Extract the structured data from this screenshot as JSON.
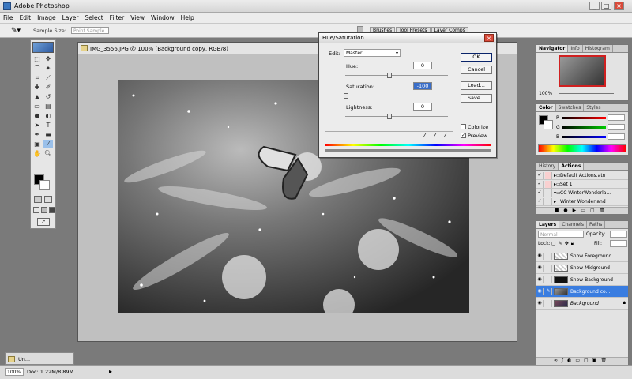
{
  "app": {
    "title": "Adobe Photoshop"
  },
  "menu": [
    "File",
    "Edit",
    "Image",
    "Layer",
    "Select",
    "Filter",
    "View",
    "Window",
    "Help"
  ],
  "options": {
    "sample_label": "Sample Size:",
    "sample_value": "Point Sample",
    "tabs": [
      "Brushes",
      "Tool Presets",
      "Layer Comps"
    ]
  },
  "document": {
    "title": "IMG_3556.JPG @ 100% (Background copy, RGB/8)"
  },
  "minimized": {
    "label": "Un..."
  },
  "dialog": {
    "title": "Hue/Saturation",
    "edit_label": "Edit:",
    "edit_value": "Master",
    "hue_label": "Hue:",
    "hue_value": "0",
    "sat_label": "Saturation:",
    "sat_value": "-100",
    "light_label": "Lightness:",
    "light_value": "0",
    "ok": "OK",
    "cancel": "Cancel",
    "load": "Load...",
    "save": "Save...",
    "colorize": "Colorize",
    "preview": "Preview"
  },
  "navigator": {
    "tabs": [
      "Navigator",
      "Info",
      "Histogram"
    ],
    "zoom": "100%"
  },
  "color": {
    "tabs": [
      "Color",
      "Swatches",
      "Styles"
    ],
    "r": "R",
    "g": "G",
    "b": "B"
  },
  "history": {
    "tabs": [
      "History",
      "Actions"
    ],
    "items": [
      "Default Actions.atn",
      "Set 1",
      "CC-WinterWonderla...",
      "Winter Wonderland"
    ]
  },
  "layers": {
    "tabs": [
      "Layers",
      "Channels",
      "Paths"
    ],
    "mode": "Normal",
    "opacity_label": "Opacity:",
    "lock_label": "Lock:",
    "fill_label": "Fill:",
    "items": [
      {
        "name": "Snow Foreground"
      },
      {
        "name": "Snow Midground"
      },
      {
        "name": "Snow Background"
      },
      {
        "name": "Background co..."
      },
      {
        "name": "Background"
      }
    ]
  },
  "status": {
    "zoom": "100%",
    "doc": "Doc: 1.22M/8.89M"
  },
  "colors": {
    "selected": "#3a7de0",
    "accent": "#0a246a"
  }
}
